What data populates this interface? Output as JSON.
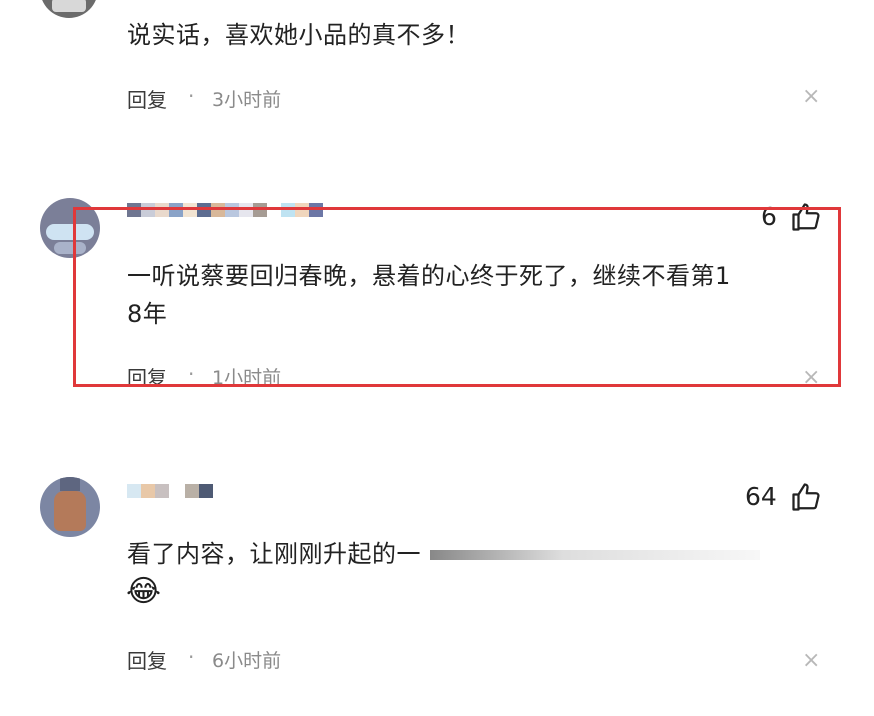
{
  "colors": {
    "highlight_border": "#e0383a",
    "text": "#222222",
    "meta": "#8a8a8a"
  },
  "comments": [
    {
      "text": "说实话，喜欢她小品的真不多！",
      "reply_label": "回复",
      "separator": "·",
      "time": "3小时前",
      "close_glyph": "×"
    },
    {
      "likes": "6",
      "text_line1": "一听说蔡要回归春晚，悬着的心终于死了，继续不看第1",
      "text_line2": "8年",
      "reply_label": "回复",
      "separator": "·",
      "time": "1小时前",
      "close_glyph": "×",
      "highlighted": true
    },
    {
      "likes": "64",
      "text": "看了内容，让刚刚升起的一",
      "emoji": "😂",
      "reply_label": "回复",
      "separator": "·",
      "time": "6小时前",
      "close_glyph": "×"
    }
  ]
}
